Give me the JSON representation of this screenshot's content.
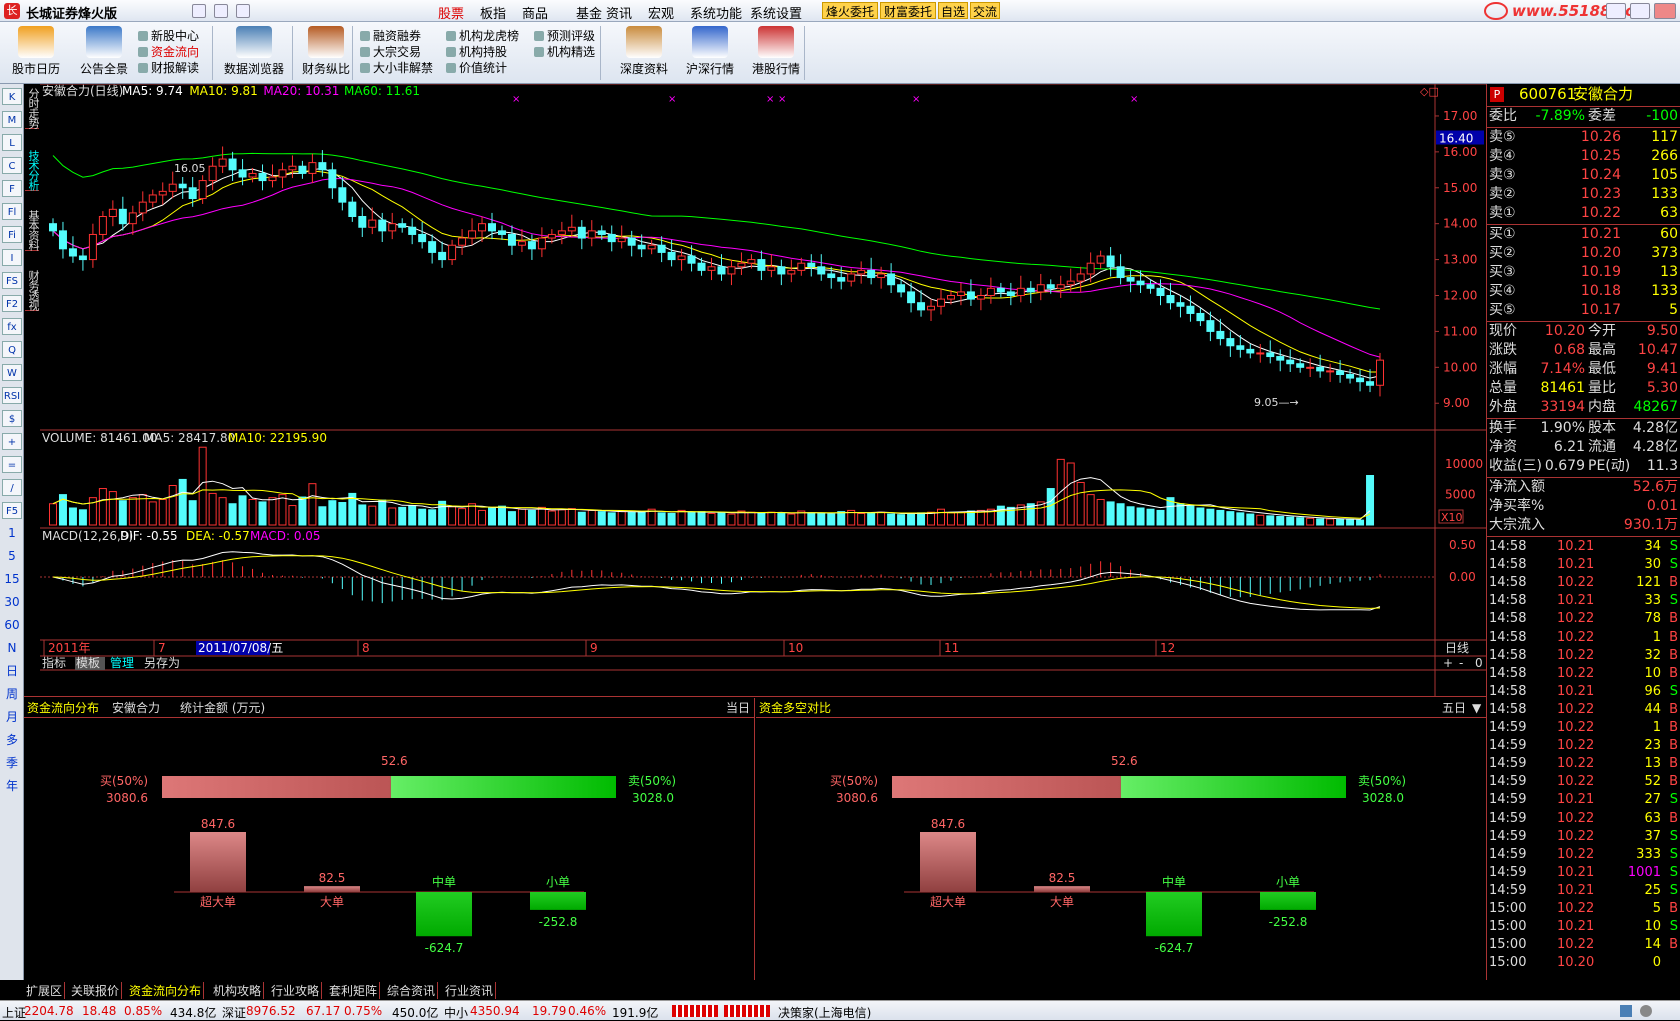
{
  "window": {
    "title": "长城证券烽火版",
    "menus": [
      "股票",
      "板指",
      "商品",
      "基金",
      "资讯",
      "宏观",
      "系统功能",
      "系统设置"
    ],
    "active_menu": "股票",
    "quick_buttons": [
      "烽火委托",
      "财富委托",
      "自选",
      "交流"
    ],
    "watermark": "www.55188.com"
  },
  "toolbar": {
    "big": [
      {
        "id": "calendar",
        "label": "股市日历",
        "icon": "calendar-icon"
      },
      {
        "id": "notice",
        "label": "公告全景",
        "icon": "megaphone-icon"
      },
      {
        "id": "databrowser",
        "label": "数据浏览器",
        "icon": "grid-icon"
      },
      {
        "id": "finance",
        "label": "财务纵比",
        "icon": "books-icon"
      },
      {
        "id": "deep",
        "label": "深度资料",
        "icon": "folder-icon"
      },
      {
        "id": "shsz",
        "label": "沪深行情",
        "icon": "chart-icon"
      },
      {
        "id": "hk",
        "label": "港股行情",
        "icon": "hk-chart-icon"
      }
    ],
    "small1": [
      "新股中心",
      "资金流向",
      "财报解读"
    ],
    "small2": [
      "融资融券",
      "大宗交易",
      "大小非解禁"
    ],
    "small3": [
      "机构龙虎榜",
      "机构持股",
      "价值统计"
    ],
    "small4": [
      "预测评级",
      "机构精选"
    ]
  },
  "sidebar_tabs": [
    "分时走势",
    "技术分析",
    "基本资料",
    "财务透视"
  ],
  "left_icons": [
    "K",
    "M",
    "L",
    "C",
    "F",
    "Fl",
    "Fi",
    "I",
    "FS",
    "F2",
    "fx",
    "Q",
    "W",
    "RSI",
    "$",
    "+",
    "=",
    "/",
    "F5",
    "1",
    "5",
    "15",
    "30",
    "60",
    "N",
    "日",
    "周",
    "月",
    "多",
    "季",
    "年"
  ],
  "chart": {
    "stock_name": "安徽合力(日线)",
    "ma_labels": [
      {
        "text": "MA5: 9.74",
        "color": "#ffffff"
      },
      {
        "text": "MA10: 9.81",
        "color": "#ffff00"
      },
      {
        "text": "MA20: 10.31",
        "color": "#ff00ff"
      },
      {
        "text": "MA60: 11.61",
        "color": "#00ff00"
      }
    ],
    "high_label": "16.05",
    "low_label": "9.05",
    "price_axis": [
      "17.00",
      "16.00",
      "15.00",
      "14.00",
      "13.00",
      "12.00",
      "11.00",
      "10.00",
      "9.00"
    ],
    "current_price": "16.40",
    "volume_label": "VOLUME: 81461.00",
    "vol_ma5": "MA5: 28417.80",
    "vol_ma10": "MA10: 22195.90",
    "vol_axis": [
      "10000",
      "5000"
    ],
    "vol_unit": "X10",
    "macd_label": "MACD(12,26,9)",
    "dif": "DIF: -0.55",
    "dea": "DEA: -0.57",
    "macd": "MACD: 0.05",
    "macd_axis": [
      "0.50",
      "0.00"
    ],
    "x_labels": [
      "2011年",
      "7",
      "8",
      "9",
      "10",
      "11",
      "12"
    ],
    "cursor_date": "2011/07/08/五",
    "period": "日线",
    "bottom_tabs": [
      "指标",
      "模板",
      "管理",
      "另存为"
    ]
  },
  "chart_data": {
    "type": "candlestick",
    "price_range": [
      8.7,
      17.5
    ],
    "close": [
      13.8,
      13.3,
      13.1,
      13.0,
      13.7,
      14.2,
      14.4,
      14.0,
      14.3,
      14.6,
      14.8,
      14.9,
      15.1,
      15.0,
      14.7,
      15.2,
      15.6,
      15.8,
      15.5,
      15.3,
      15.4,
      15.2,
      15.3,
      15.5,
      15.6,
      15.4,
      15.7,
      15.5,
      15.0,
      14.6,
      14.2,
      13.9,
      14.1,
      13.8,
      14.0,
      13.9,
      13.7,
      13.5,
      13.2,
      13.0,
      13.4,
      13.6,
      13.8,
      14.0,
      13.8,
      13.7,
      13.4,
      13.5,
      13.3,
      13.6,
      13.7,
      13.8,
      13.9,
      13.6,
      13.8,
      13.7,
      13.5,
      13.6,
      13.4,
      13.3,
      13.4,
      13.2,
      13.0,
      13.1,
      12.9,
      12.7,
      12.8,
      12.6,
      12.8,
      12.9,
      13.0,
      12.7,
      12.8,
      12.6,
      12.7,
      12.9,
      12.8,
      12.6,
      12.5,
      12.4,
      12.6,
      12.7,
      12.5,
      12.6,
      12.3,
      12.1,
      11.8,
      11.6,
      11.7,
      11.9,
      12.0,
      12.1,
      11.9,
      12.0,
      12.2,
      12.1,
      12.0,
      12.2,
      12.1,
      12.3,
      12.2,
      12.3,
      12.4,
      12.6,
      12.9,
      13.1,
      12.8,
      12.5,
      12.4,
      12.3,
      12.2,
      12.0,
      11.8,
      11.7,
      11.5,
      11.3,
      11.0,
      10.8,
      10.6,
      10.5,
      10.4,
      10.4,
      10.3,
      10.2,
      10.1,
      10.0,
      10.0,
      9.9,
      9.9,
      9.8,
      9.7,
      9.6,
      9.5,
      10.2
    ],
    "volume": [
      3500,
      5000,
      2800,
      2500,
      4500,
      6000,
      5500,
      4000,
      4500,
      5000,
      3800,
      4200,
      6500,
      7500,
      4000,
      12800,
      5200,
      4500,
      3500,
      4800,
      4200,
      3800,
      4500,
      5000,
      3200,
      4600,
      6800,
      3000,
      4000,
      3700,
      5200,
      3300,
      3100,
      4100,
      2800,
      2900,
      3200,
      2600,
      2500,
      3900,
      3000,
      2700,
      3500,
      2400,
      2800,
      3100,
      2200,
      2600,
      2400,
      2900,
      2300,
      2500,
      2700,
      2100,
      2400,
      2200,
      2000,
      2300,
      2100,
      2200,
      2600,
      2000,
      1900,
      2400,
      2100,
      2200,
      1900,
      2000,
      1800,
      2300,
      2100,
      1900,
      2100,
      2000,
      1800,
      2300,
      2000,
      1900,
      1800,
      2200,
      2400,
      1900,
      2000,
      2100,
      1800,
      1700,
      1900,
      2000,
      2100,
      2600,
      2000,
      2100,
      2300,
      2400,
      2600,
      3100,
      2900,
      3300,
      3500,
      3800,
      6000,
      10800,
      10200,
      7000,
      5000,
      4200,
      3800,
      3500,
      3000,
      2800,
      2600,
      2400,
      4500,
      3500,
      3200,
      2800,
      2600,
      2400,
      2200,
      2000,
      1800,
      1600,
      1500,
      1400,
      1300,
      1200,
      1100,
      1000,
      1000,
      900,
      900,
      800,
      8146
    ]
  },
  "indicator_tabs": [
    "资金流向分布",
    "安徽合力",
    "统计金额 (万元)"
  ],
  "today_label": "当日",
  "flow": {
    "buy_pct": "买(50%)",
    "buy_val": "3080.6",
    "sell_pct": "卖(50%)",
    "sell_val": "3028.0",
    "net": "52.6",
    "bars": [
      {
        "name": "超大单",
        "value": "847.6"
      },
      {
        "name": "大单",
        "value": "82.5"
      },
      {
        "name": "中单",
        "value": "-624.7"
      },
      {
        "name": "小单",
        "value": "-252.8"
      }
    ]
  },
  "flow2_title": "资金多空对比",
  "five_day": "五日",
  "quote": {
    "code": "600761",
    "name": "安徽合力",
    "wb_l": "委比",
    "wb": "-7.89%",
    "wc_l": "委差",
    "wc": "-100",
    "asks": [
      {
        "l": "卖⑤",
        "p": "10.26",
        "v": "117"
      },
      {
        "l": "卖④",
        "p": "10.25",
        "v": "266"
      },
      {
        "l": "卖③",
        "p": "10.24",
        "v": "105"
      },
      {
        "l": "卖②",
        "p": "10.23",
        "v": "133"
      },
      {
        "l": "卖①",
        "p": "10.22",
        "v": "63"
      }
    ],
    "bids": [
      {
        "l": "买①",
        "p": "10.21",
        "v": "60"
      },
      {
        "l": "买②",
        "p": "10.20",
        "v": "373"
      },
      {
        "l": "买③",
        "p": "10.19",
        "v": "13"
      },
      {
        "l": "买④",
        "p": "10.18",
        "v": "133"
      },
      {
        "l": "买⑤",
        "p": "10.17",
        "v": "5"
      }
    ],
    "stats": [
      {
        "l1": "现价",
        "v1": "10.20",
        "c1": "#ff4444",
        "l2": "今开",
        "v2": "9.50",
        "c2": "#ff4444"
      },
      {
        "l1": "涨跌",
        "v1": "0.68",
        "c1": "#ff4444",
        "l2": "最高",
        "v2": "10.47",
        "c2": "#ff4444"
      },
      {
        "l1": "涨幅",
        "v1": "7.14%",
        "c1": "#ff4444",
        "l2": "最低",
        "v2": "9.41",
        "c2": "#ff4444"
      },
      {
        "l1": "总量",
        "v1": "81461",
        "c1": "#ffff00",
        "l2": "量比",
        "v2": "5.30",
        "c2": "#ff4444"
      },
      {
        "l1": "外盘",
        "v1": "33194",
        "c1": "#ff4444",
        "l2": "内盘",
        "v2": "48267",
        "c2": "#00ff00"
      }
    ],
    "stats2": [
      {
        "l1": "换手",
        "v1": "1.90%",
        "l2": "股本",
        "v2": "4.28亿"
      },
      {
        "l1": "净资",
        "v1": "6.21",
        "l2": "流通",
        "v2": "4.28亿"
      },
      {
        "l1": "收益(三)",
        "v1": "0.679",
        "l2": "PE(动)",
        "v2": "11.3"
      }
    ],
    "flows": [
      {
        "l": "净流入额",
        "v": "52.6万"
      },
      {
        "l": "净买率%",
        "v": "0.01"
      },
      {
        "l": "大宗流入",
        "v": "930.1万"
      }
    ],
    "ticks": [
      [
        "14:58",
        "10.21",
        "34",
        "S"
      ],
      [
        "14:58",
        "10.21",
        "30",
        "S"
      ],
      [
        "14:58",
        "10.22",
        "121",
        "B"
      ],
      [
        "14:58",
        "10.21",
        "33",
        "S"
      ],
      [
        "14:58",
        "10.22",
        "78",
        "B"
      ],
      [
        "14:58",
        "10.22",
        "1",
        "B"
      ],
      [
        "14:58",
        "10.22",
        "32",
        "B"
      ],
      [
        "14:58",
        "10.22",
        "10",
        "B"
      ],
      [
        "14:58",
        "10.21",
        "96",
        "S"
      ],
      [
        "14:58",
        "10.22",
        "44",
        "B"
      ],
      [
        "14:59",
        "10.22",
        "1",
        "B"
      ],
      [
        "14:59",
        "10.22",
        "23",
        "B"
      ],
      [
        "14:59",
        "10.22",
        "13",
        "B"
      ],
      [
        "14:59",
        "10.22",
        "52",
        "B"
      ],
      [
        "14:59",
        "10.21",
        "27",
        "S"
      ],
      [
        "14:59",
        "10.22",
        "63",
        "B"
      ],
      [
        "14:59",
        "10.22",
        "37",
        "S"
      ],
      [
        "14:59",
        "10.22",
        "333",
        "S"
      ],
      [
        "14:59",
        "10.21",
        "1001",
        "S"
      ],
      [
        "14:59",
        "10.21",
        "25",
        "S"
      ],
      [
        "15:00",
        "10.22",
        "5",
        "B"
      ],
      [
        "15:00",
        "10.21",
        "10",
        "S"
      ],
      [
        "15:00",
        "10.22",
        "14",
        "B"
      ],
      [
        "15:00",
        "10.20",
        "0",
        ""
      ]
    ],
    "bottom_tabs": [
      "笔",
      "价",
      "细",
      "盘",
      "势",
      "指",
      "值",
      "筹"
    ]
  },
  "bottom_tabs": [
    "扩展区",
    "关联报价",
    "资金流向分布",
    "机构攻略",
    "行业攻略",
    "套利矩阵",
    "综合资讯",
    "行业资讯"
  ],
  "status": {
    "sh_l": "上证",
    "sh": "2204.78",
    "sh_ch": "18.48",
    "sh_pct": "0.85%",
    "sh_amt": "434.8亿",
    "sz_l": "深证",
    "sz": "8976.52",
    "sz_ch": "67.17",
    "sz_pct": "0.75%",
    "sz_amt": "450.0亿",
    "zx_l": "中小",
    "zx": "4350.94",
    "zx_ch": "19.79",
    "zx_pct": "0.46%",
    "zx_amt": "191.9亿",
    "server": "决策家(上海电信)"
  }
}
